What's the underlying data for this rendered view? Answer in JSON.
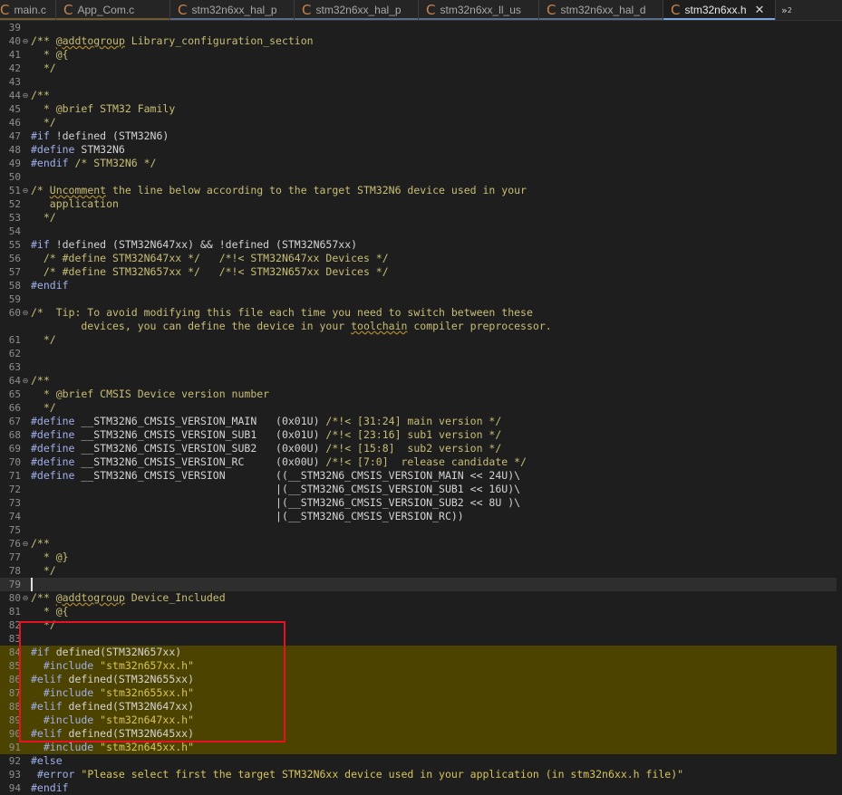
{
  "tabs": [
    {
      "label": "main.c",
      "icon": "c-file-icon",
      "active": false,
      "underline": "#6d5a32"
    },
    {
      "label": "App_Com.c",
      "icon": "c-file-icon",
      "active": false,
      "underline": "#6d5a32"
    },
    {
      "label": "stm32n6xx_hal_p",
      "icon": "c-file-icon",
      "active": false,
      "underline": "#5b6b8a"
    },
    {
      "label": "stm32n6xx_hal_p",
      "icon": "c-file-icon",
      "active": false,
      "underline": "#5b6b8a"
    },
    {
      "label": "stm32n6xx_ll_us",
      "icon": "c-file-icon",
      "active": false,
      "underline": "#5b6b8a"
    },
    {
      "label": "stm32n6xx_hal_d",
      "icon": "c-file-icon",
      "active": false,
      "underline": "#5b6b8a"
    },
    {
      "label": "stm32n6xx.h",
      "icon": "c-file-icon",
      "active": true,
      "underline": "#7aa7e0"
    }
  ],
  "tab_overflow": {
    "label": "»",
    "count": "2"
  },
  "colors": {
    "background": "#1e1e1e",
    "highlight": "#4d4300",
    "selection_box": "#e81123",
    "comment": "#c9be74",
    "directive": "#9fb0ec",
    "string": "#d7c45a"
  },
  "editor": {
    "cursor_line": 79,
    "highlight_lines": [
      84,
      91
    ],
    "lines": [
      {
        "n": "39",
        "t": []
      },
      {
        "n": "40",
        "fold": true,
        "t": [
          [
            "c",
            "/** "
          ],
          [
            "sq",
            "@addtogroup"
          ],
          [
            "c",
            " Library_configuration_section"
          ]
        ]
      },
      {
        "n": "41",
        "t": [
          [
            "c",
            "  * @{"
          ]
        ]
      },
      {
        "n": "42",
        "t": [
          [
            "c",
            "  */"
          ]
        ]
      },
      {
        "n": "43",
        "t": []
      },
      {
        "n": "44",
        "fold": true,
        "t": [
          [
            "c",
            "/**"
          ]
        ]
      },
      {
        "n": "45",
        "t": [
          [
            "c",
            "  * @brief STM32 Family"
          ]
        ]
      },
      {
        "n": "46",
        "t": [
          [
            "c",
            "  */"
          ]
        ]
      },
      {
        "n": "47",
        "t": [
          [
            "d",
            "#if"
          ],
          [
            "x",
            " !defined (STM32N6)"
          ]
        ]
      },
      {
        "n": "48",
        "t": [
          [
            "d",
            "#define"
          ],
          [
            "x",
            " STM32N6"
          ]
        ]
      },
      {
        "n": "49",
        "t": [
          [
            "d",
            "#endif"
          ],
          [
            "c",
            " /* STM32N6 */"
          ]
        ]
      },
      {
        "n": "50",
        "t": []
      },
      {
        "n": "51",
        "fold": true,
        "t": [
          [
            "c",
            "/* "
          ],
          [
            "sq",
            "Uncomment"
          ],
          [
            "c",
            " the line below according to the target STM32N6 device used in your"
          ]
        ]
      },
      {
        "n": "52",
        "t": [
          [
            "c",
            "   application"
          ]
        ]
      },
      {
        "n": "53",
        "t": [
          [
            "c",
            "  */"
          ]
        ]
      },
      {
        "n": "54",
        "t": []
      },
      {
        "n": "55",
        "t": [
          [
            "d",
            "#if"
          ],
          [
            "x",
            " !defined (STM32N647xx) && !defined (STM32N657xx)"
          ]
        ]
      },
      {
        "n": "56",
        "t": [
          [
            "c",
            "  /* #define STM32N647xx */   /*!< STM32N647xx Devices */"
          ]
        ]
      },
      {
        "n": "57",
        "t": [
          [
            "c",
            "  /* #define STM32N657xx */   /*!< STM32N657xx Devices */"
          ]
        ]
      },
      {
        "n": "58",
        "t": [
          [
            "d",
            "#endif"
          ]
        ]
      },
      {
        "n": "59",
        "t": []
      },
      {
        "n": "60",
        "fold": true,
        "t": [
          [
            "c",
            "/*  Tip: To avoid modifying this file each time you need to switch between these"
          ]
        ]
      },
      {
        "n": "",
        "t": [
          [
            "c",
            "        devices, you can define the device in your "
          ],
          [
            "sq",
            "toolchain"
          ],
          [
            "c",
            " compiler preprocessor."
          ]
        ]
      },
      {
        "n": "61",
        "t": [
          [
            "c",
            "  */"
          ]
        ]
      },
      {
        "n": "62",
        "t": []
      },
      {
        "n": "63",
        "t": []
      },
      {
        "n": "64",
        "fold": true,
        "t": [
          [
            "c",
            "/**"
          ]
        ]
      },
      {
        "n": "65",
        "t": [
          [
            "c",
            "  * @brief CMSIS Device version number"
          ]
        ]
      },
      {
        "n": "66",
        "t": [
          [
            "c",
            "  */"
          ]
        ]
      },
      {
        "n": "67",
        "t": [
          [
            "d",
            "#define"
          ],
          [
            "x",
            " __STM32N6_CMSIS_VERSION_MAIN   (0x01U) "
          ],
          [
            "c",
            "/*!< [31:24] main version */"
          ]
        ]
      },
      {
        "n": "68",
        "t": [
          [
            "d",
            "#define"
          ],
          [
            "x",
            " __STM32N6_CMSIS_VERSION_SUB1   (0x01U) "
          ],
          [
            "c",
            "/*!< [23:16] sub1 version */"
          ]
        ]
      },
      {
        "n": "69",
        "t": [
          [
            "d",
            "#define"
          ],
          [
            "x",
            " __STM32N6_CMSIS_VERSION_SUB2   (0x00U) "
          ],
          [
            "c",
            "/*!< [15:8]  sub2 version */"
          ]
        ]
      },
      {
        "n": "70",
        "t": [
          [
            "d",
            "#define"
          ],
          [
            "x",
            " __STM32N6_CMSIS_VERSION_RC     (0x00U) "
          ],
          [
            "c",
            "/*!< [7:0]  release candidate */"
          ]
        ]
      },
      {
        "n": "71",
        "t": [
          [
            "d",
            "#define"
          ],
          [
            "x",
            " __STM32N6_CMSIS_VERSION        ((__STM32N6_CMSIS_VERSION_MAIN << 24U)\\"
          ]
        ]
      },
      {
        "n": "72",
        "t": [
          [
            "x",
            "                                       |(__STM32N6_CMSIS_VERSION_SUB1 << 16U)\\"
          ]
        ]
      },
      {
        "n": "73",
        "t": [
          [
            "x",
            "                                       |(__STM32N6_CMSIS_VERSION_SUB2 << 8U )\\"
          ]
        ]
      },
      {
        "n": "74",
        "t": [
          [
            "x",
            "                                       |(__STM32N6_CMSIS_VERSION_RC))"
          ]
        ]
      },
      {
        "n": "75",
        "t": []
      },
      {
        "n": "76",
        "fold": true,
        "t": [
          [
            "c",
            "/**"
          ]
        ]
      },
      {
        "n": "77",
        "t": [
          [
            "c",
            "  * @}"
          ]
        ]
      },
      {
        "n": "78",
        "t": [
          [
            "c",
            "  */"
          ]
        ]
      },
      {
        "n": "79",
        "t": []
      },
      {
        "n": "80",
        "fold": true,
        "t": [
          [
            "c",
            "/** "
          ],
          [
            "sq",
            "@addtogroup"
          ],
          [
            "c",
            " Device_Included"
          ]
        ]
      },
      {
        "n": "81",
        "t": [
          [
            "c",
            "  * @{"
          ]
        ]
      },
      {
        "n": "82",
        "t": [
          [
            "c",
            "  */"
          ]
        ]
      },
      {
        "n": "83",
        "t": []
      },
      {
        "n": "84",
        "t": [
          [
            "d",
            "#if"
          ],
          [
            "x",
            " defined(STM32N657xx)"
          ]
        ]
      },
      {
        "n": "85",
        "t": [
          [
            "d",
            "  #include"
          ],
          [
            "s",
            " \"stm32n657xx.h\""
          ]
        ]
      },
      {
        "n": "86",
        "t": [
          [
            "d",
            "#elif"
          ],
          [
            "x",
            " defined(STM32N655xx)"
          ]
        ]
      },
      {
        "n": "87",
        "t": [
          [
            "d",
            "  #include"
          ],
          [
            "s",
            " \"stm32n655xx.h\""
          ]
        ]
      },
      {
        "n": "88",
        "t": [
          [
            "d",
            "#elif"
          ],
          [
            "x",
            " defined(STM32N647xx)"
          ]
        ]
      },
      {
        "n": "89",
        "t": [
          [
            "d",
            "  #include"
          ],
          [
            "s",
            " \"stm32n647xx.h\""
          ]
        ]
      },
      {
        "n": "90",
        "t": [
          [
            "d",
            "#elif"
          ],
          [
            "x",
            " defined(STM32N645xx)"
          ]
        ]
      },
      {
        "n": "91",
        "t": [
          [
            "d",
            "  #include"
          ],
          [
            "s",
            " \"stm32n645xx.h\""
          ]
        ]
      },
      {
        "n": "92",
        "t": [
          [
            "d",
            "#else"
          ]
        ]
      },
      {
        "n": "93",
        "t": [
          [
            "d",
            " #error"
          ],
          [
            "s",
            " \"Please select first the target STM32N6xx device used in your application (in stm32n6xx.h file)\""
          ]
        ]
      },
      {
        "n": "94",
        "t": [
          [
            "d",
            "#endif"
          ]
        ]
      }
    ]
  }
}
